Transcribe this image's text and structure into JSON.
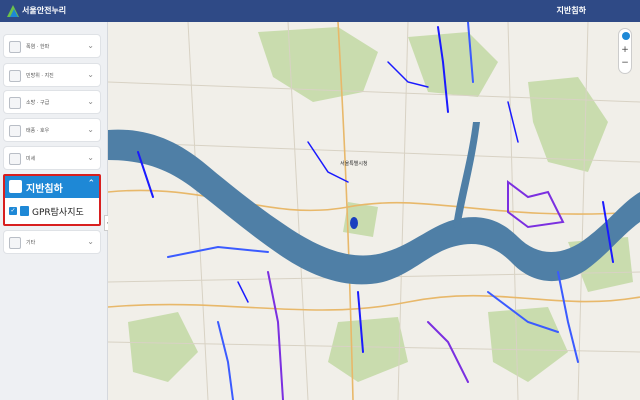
{
  "header": {
    "app_title": "서울안전누리",
    "page_title": "지반침하",
    "bg_color": "#2f4a86"
  },
  "sidebar": {
    "categories": [
      {
        "label": "폭염 · 한파",
        "icon": "sun-icon"
      },
      {
        "label": "민방위 · 지진",
        "icon": "siren-icon"
      },
      {
        "label": "소방 · 구급",
        "icon": "fire-icon"
      },
      {
        "label": "태풍 · 호우",
        "icon": "typhoon-icon"
      },
      {
        "label": "미세",
        "icon": "dust-icon"
      }
    ],
    "active_category": {
      "label": "지반침하",
      "icon": "subsidence-icon",
      "layer_label": "GPR탐사지도",
      "layer_checked": true
    },
    "other_category": {
      "label": "기타",
      "icon": "etc-icon"
    }
  },
  "map": {
    "river_color": "#4f7fa6",
    "park_color": "#c9dcae",
    "land_color": "#f1efe9",
    "survey_line_colors": [
      "#1a1aff",
      "#7b2fe0",
      "#3b5bff"
    ],
    "place_labels": [
      "서울특별시청"
    ]
  }
}
